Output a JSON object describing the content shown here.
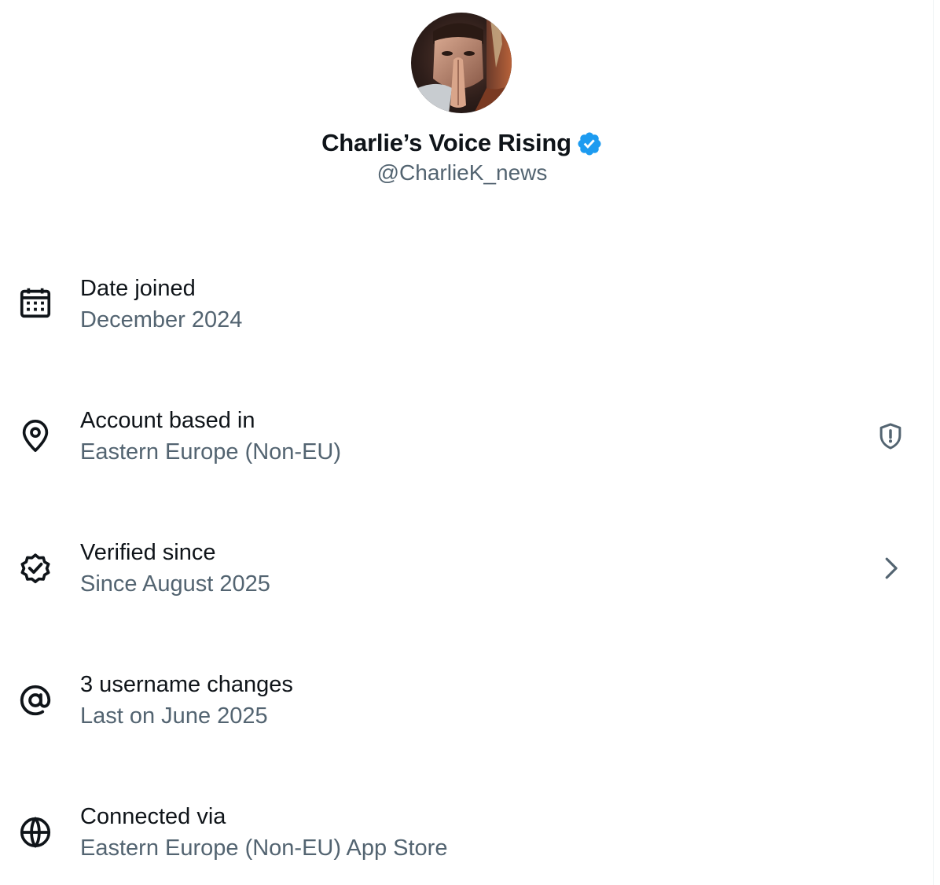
{
  "profile": {
    "display_name": "Charlie’s Voice Rising",
    "handle": "@CharlieK_news",
    "avatar_icon": "profile-avatar-photo",
    "verified_icon": "verified-badge-icon",
    "verified_color": "#1d9bf0"
  },
  "rows": [
    {
      "icon": "calendar-icon",
      "title": "Date joined",
      "value": "December 2024"
    },
    {
      "icon": "location-pin-icon",
      "title": "Account based in",
      "value": "Eastern Europe (Non-EU)",
      "trailing_icon": "shield-alert-icon"
    },
    {
      "icon": "verified-check-icon",
      "title": "Verified since",
      "value": "Since August 2025",
      "trailing_icon": "chevron-right-icon"
    },
    {
      "icon": "at-sign-icon",
      "title": "3 username changes",
      "value": "Last on June 2025"
    },
    {
      "icon": "globe-icon",
      "title": "Connected via",
      "value": "Eastern Europe (Non-EU) App Store"
    }
  ],
  "colors": {
    "primary_text": "#0f1419",
    "secondary_text": "#536471",
    "background": "#ffffff"
  }
}
